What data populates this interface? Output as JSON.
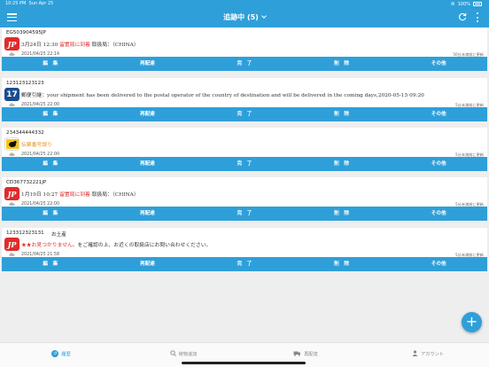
{
  "status_bar": {
    "time": "10:25 PM",
    "date": "Sun Apr 25",
    "battery": "100%"
  },
  "header": {
    "title": "追跡中 (5)"
  },
  "actions": [
    "編　集",
    "再配達",
    "完　了",
    "削　除",
    "その他"
  ],
  "cards": [
    {
      "tracking": "EG503904595JP",
      "memo": "",
      "carrier": "japan-post",
      "carrier_mark": "JP",
      "status_time": "3月24日 12:30 ",
      "status_main": "留置局に到着",
      "status_extra": " 取扱局：（CHINA）",
      "status_color": "#e02b2b",
      "date": "2021/04/25 22:14",
      "updated": "50分未満前に更新"
    },
    {
      "tracking": "123123123123",
      "memo": "",
      "carrier": "17track",
      "carrier_mark": "17",
      "status_time": "",
      "status_main": "郵便引継：your shipment has been delivered to the postal operator of the country of destination and will be delivered in the coming days,2020-05-15 09:20",
      "status_extra": "",
      "status_color": "#333333",
      "date": "2021/04/25 22:00",
      "updated": "5分未満前に更新"
    },
    {
      "tracking": "234344444332",
      "memo": "",
      "carrier": "yamato",
      "carrier_mark": "",
      "status_time": "",
      "status_main": "伝票番号誤り",
      "status_extra": "",
      "status_color": "#e8921d",
      "date": "2021/04/25 22:00",
      "updated": "5分未満前に更新"
    },
    {
      "tracking": "CD367732221JP",
      "memo": "",
      "carrier": "japan-post",
      "carrier_mark": "JP",
      "status_time": "1月19日 10:27 ",
      "status_main": "留置局に到着",
      "status_extra": " 取扱局：（CHINA）",
      "status_color": "#e02b2b",
      "date": "2021/04/25 22:00",
      "updated": "5分未満前に更新"
    },
    {
      "tracking": "123312323131",
      "memo": "お土産",
      "carrier": "japan-post",
      "carrier_mark": "JP",
      "status_time": "",
      "status_main": "★★お見つかりません。",
      "status_extra": "をご確認の上、お近くの取扱店にお問い合わせください。",
      "status_color": "#e02b2b",
      "date": "2021/04/25 21:58",
      "updated": "5分未満前に更新"
    }
  ],
  "tabs": [
    {
      "label": "履歴",
      "icon": "history-icon"
    },
    {
      "label": "荷物追加",
      "icon": "search-icon"
    },
    {
      "label": "再配達",
      "icon": "truck-icon"
    },
    {
      "label": "アカウント",
      "icon": "person-icon"
    }
  ],
  "fab": {
    "label": "+"
  },
  "colors": {
    "primary": "#2f9fd9",
    "alert": "#e02b2b",
    "warning": "#e8921d"
  }
}
